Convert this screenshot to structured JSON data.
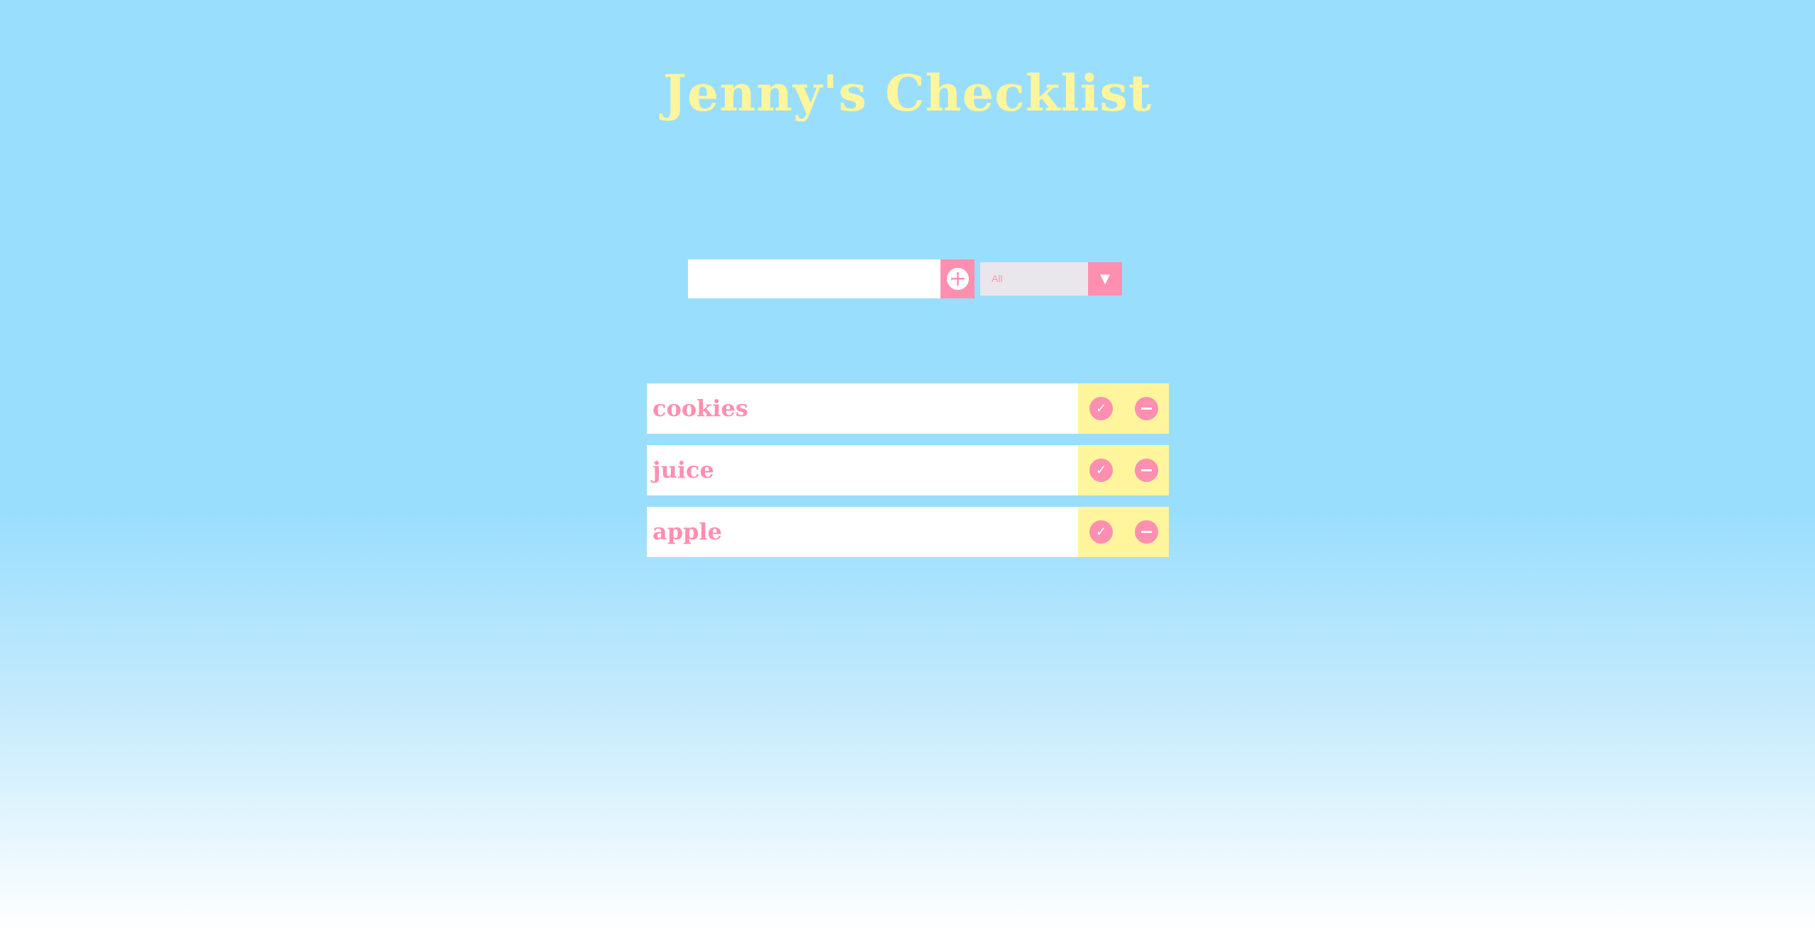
{
  "app": {
    "title": "Jenny's Checklist"
  },
  "form": {
    "input_value": "",
    "add_icon": "plus-icon",
    "filter": {
      "selected": "All",
      "arrow_glyph": "▼"
    }
  },
  "todos": [
    {
      "text": "cookies"
    },
    {
      "text": "juice"
    },
    {
      "text": "apple"
    }
  ],
  "icons": {
    "complete": "check-icon",
    "delete": "minus-icon"
  },
  "colors": {
    "background_top": "#9adefd",
    "background_bottom": "#ffffff",
    "accent_pink": "#ff8fb0",
    "accent_yellow": "#fff59d",
    "select_grey": "#eae7ec"
  }
}
